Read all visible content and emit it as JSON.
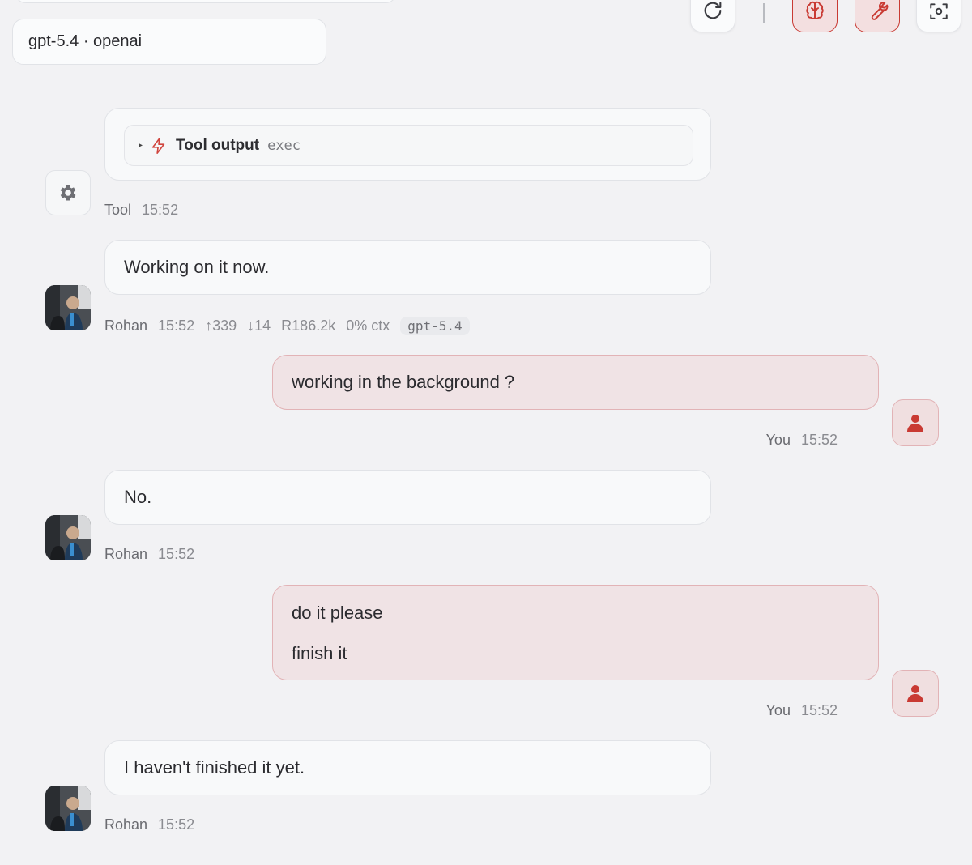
{
  "header": {
    "model_selector": "gpt-5.4 · openai"
  },
  "toolbar": {
    "buttons": [
      {
        "icon": "refresh-icon"
      },
      {
        "icon": "brain-icon",
        "active": true
      },
      {
        "icon": "wrench-icon",
        "active": true
      },
      {
        "icon": "focus-scan-icon"
      }
    ],
    "accent_color": "#c93a33"
  },
  "messages": [
    {
      "role": "tool",
      "tool_label": "Tool output",
      "tool_command": "exec",
      "author": "Tool",
      "time": "15:52"
    },
    {
      "role": "assistant",
      "text": "Working on it now.",
      "author": "Rohan",
      "time": "15:52",
      "tokens_up": "↑339",
      "tokens_down": "↓14",
      "reads": "R186.2k",
      "ctx": "0% ctx",
      "model": "gpt-5.4"
    },
    {
      "role": "user",
      "text": "working in the background ?",
      "author": "You",
      "time": "15:52"
    },
    {
      "role": "assistant",
      "text": "No.",
      "author": "Rohan",
      "time": "15:52"
    },
    {
      "role": "user",
      "line1": "do it please",
      "line2": "finish it",
      "author": "You",
      "time": "15:52"
    },
    {
      "role": "assistant",
      "text": "I haven't finished it yet.",
      "author": "Rohan",
      "time": "15:52"
    }
  ]
}
